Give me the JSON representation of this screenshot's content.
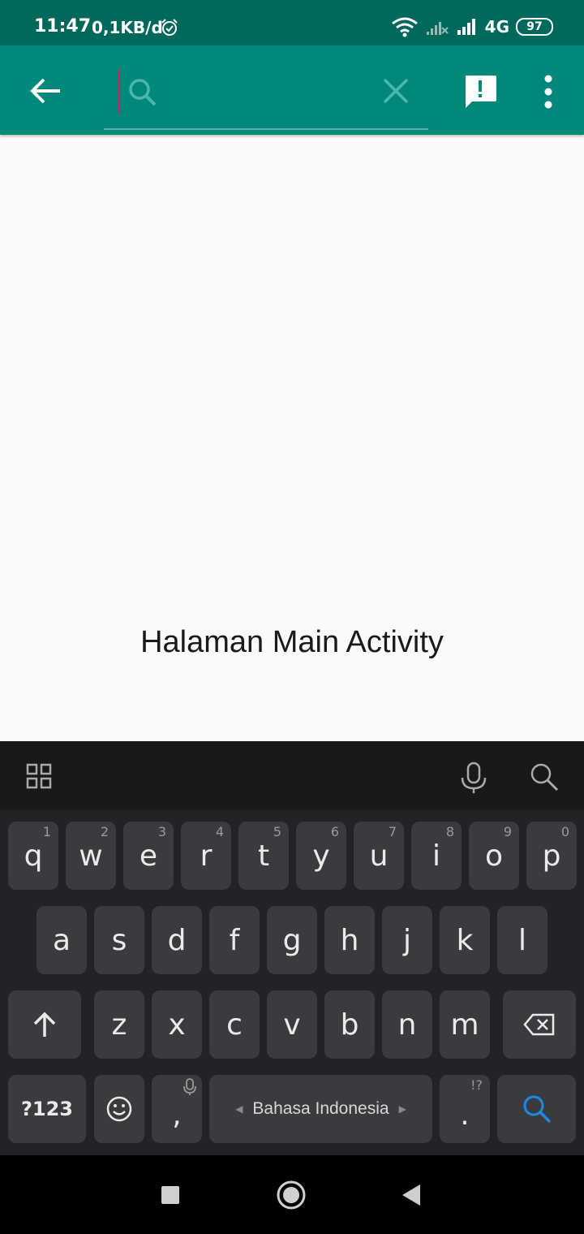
{
  "status_bar": {
    "time": "11:47",
    "speed": "0,1KB/d",
    "network": "4G",
    "battery": "97"
  },
  "app_bar": {
    "search_placeholder": ""
  },
  "main": {
    "text": "Halaman Main Activity"
  },
  "keyboard": {
    "row1": [
      {
        "key": "q",
        "hint": "1"
      },
      {
        "key": "w",
        "hint": "2"
      },
      {
        "key": "e",
        "hint": "3"
      },
      {
        "key": "r",
        "hint": "4"
      },
      {
        "key": "t",
        "hint": "5"
      },
      {
        "key": "y",
        "hint": "6"
      },
      {
        "key": "u",
        "hint": "7"
      },
      {
        "key": "i",
        "hint": "8"
      },
      {
        "key": "o",
        "hint": "9"
      },
      {
        "key": "p",
        "hint": "0"
      }
    ],
    "row2": [
      "a",
      "s",
      "d",
      "f",
      "g",
      "h",
      "j",
      "k",
      "l"
    ],
    "row3": [
      "z",
      "x",
      "c",
      "v",
      "b",
      "n",
      "m"
    ],
    "symbols_label": "?123",
    "comma": ",",
    "space_label": "Bahasa Indonesia",
    "period": ".",
    "period_hint": "!?"
  }
}
